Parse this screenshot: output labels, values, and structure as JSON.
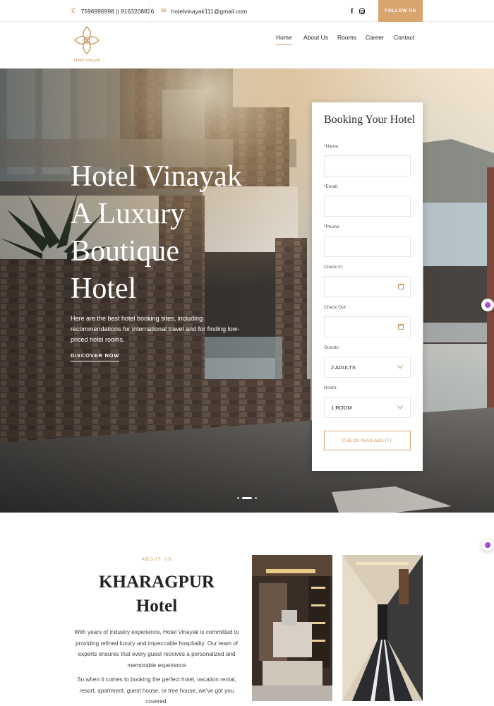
{
  "topbar": {
    "phone_icon": "phone-icon",
    "phones": "7596996998 || 9163208826",
    "mail_icon": "mail-icon",
    "email": "hotelvinayak111@gmail.com",
    "social": [
      "facebook-icon",
      "instagram-icon"
    ],
    "follow_label": "FOLLOW US"
  },
  "brand": {
    "logo_text": "Hotel Vinayak",
    "accent_color": "#c9935a"
  },
  "nav": {
    "items": [
      {
        "label": "Home",
        "active": true
      },
      {
        "label": "About Us",
        "active": false
      },
      {
        "label": "Rooms",
        "active": false
      },
      {
        "label": "Career",
        "active": false
      },
      {
        "label": "Contact",
        "active": false
      }
    ]
  },
  "hero": {
    "title_lines": [
      "Hotel Vinayak",
      "A Luxury",
      "Boutique",
      "Hotel"
    ],
    "subtitle": "Here are the best hotel booking sites, including recommendations for international travel and for finding low-priced hotel rooms.",
    "cta": "DISCOVER NOW",
    "slides": 3,
    "active_slide": 2
  },
  "booking": {
    "title": "Booking Your Hotel",
    "fields": {
      "name_label": "*Name:",
      "email_label": "*Email:",
      "phone_label": "*Phone:",
      "checkin_label": "Check In:",
      "checkout_label": "Check Out:",
      "guests_label": "Guests:",
      "guests_value": "2 ADULTS",
      "room_label": "Room:",
      "room_value": "1 ROOM"
    },
    "submit_label": "CHECK AVAILABILITY"
  },
  "about": {
    "eyebrow": "ABOUT US",
    "title_line1": "KHARAGPUR",
    "title_line2": "Hotel",
    "paragraph1": "With years of industry experience, Hotel Vinayak is committed to providing refined luxury and impeccable hospitality. Our team of experts ensures that every guest receives a personalized and memorable experience",
    "paragraph2": "So when it comes to booking the perfect hotel, vacation rental, resort, apartment, guest house, or tree house, we've got you covered."
  }
}
